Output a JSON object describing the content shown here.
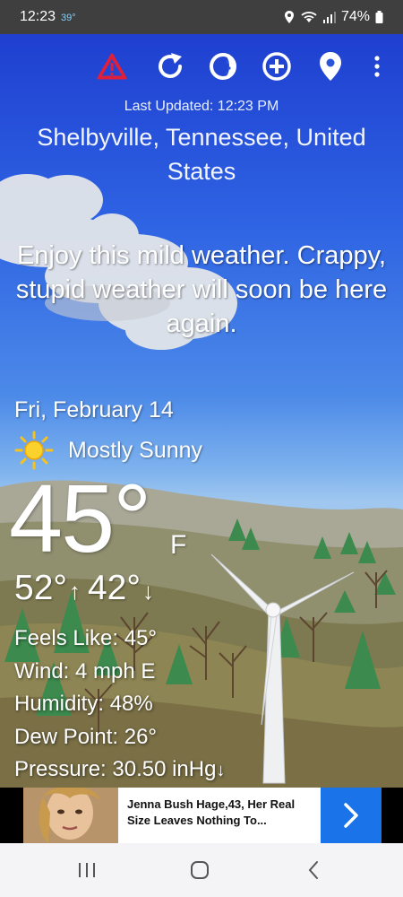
{
  "status_bar": {
    "time": "12:23",
    "temp": "39°",
    "battery": "74%"
  },
  "toolbar": {
    "icons": [
      "warning-icon",
      "refresh-icon",
      "theme-icon",
      "add-icon",
      "location-icon",
      "more-icon"
    ]
  },
  "header": {
    "last_updated": "Last Updated: 12:23 PM",
    "location": "Shelbyville, Tennessee, United States"
  },
  "snark": "Enjoy this mild weather. Crappy, stupid weather will soon be here again.",
  "current": {
    "date": "Fri, February 14",
    "condition": "Mostly Sunny",
    "temp": "45°",
    "unit": "F",
    "high": "52°",
    "high_arrow": "↑",
    "low": "42°",
    "low_arrow": "↓"
  },
  "details": {
    "feels_like": "Feels Like:  45°",
    "wind": "Wind:  4 mph E",
    "humidity": "Humidity:  48%",
    "dew_point": "Dew Point:  26°",
    "pressure": "Pressure:  30.50 inHg",
    "pressure_arrow": "↓"
  },
  "ad": {
    "text": "Jenna Bush Hage,43, Her Real Size Leaves Nothing To..."
  },
  "colors": {
    "warning": "#e0203a",
    "ad_accent": "#1a73e8"
  }
}
